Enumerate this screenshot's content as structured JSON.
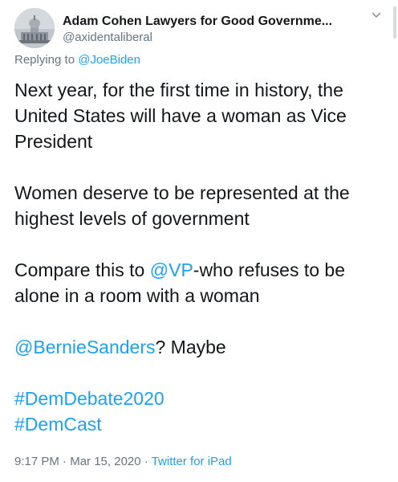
{
  "author": {
    "display_name": "Adam Cohen Lawyers for Good Governme...",
    "handle": "@axidentaliberal",
    "avatar_icon": "capitol-building-avatar"
  },
  "reply": {
    "prefix": "Replying to",
    "mention": "@JoeBiden"
  },
  "body": {
    "line1": "Next year, for the first time in history, the United States will have a woman as Vice President",
    "line2": "Women deserve to be represented at the highest levels of government",
    "line3_pre": "Compare this to ",
    "line3_mention": "@VP",
    "line3_post": "-who refuses to be alone in a room with a woman",
    "line4_mention": "@BernieSanders",
    "line4_post": "? Maybe",
    "hashtag1": "#DemDebate2020",
    "hashtag2": "#DemCast"
  },
  "meta": {
    "time": "9:17 PM",
    "separator": "·",
    "date": "Mar 15, 2020",
    "source": "Twitter for iPad"
  },
  "colors": {
    "link": "#1da1f2",
    "secondary_text": "#657786",
    "primary_text": "#14171a"
  }
}
